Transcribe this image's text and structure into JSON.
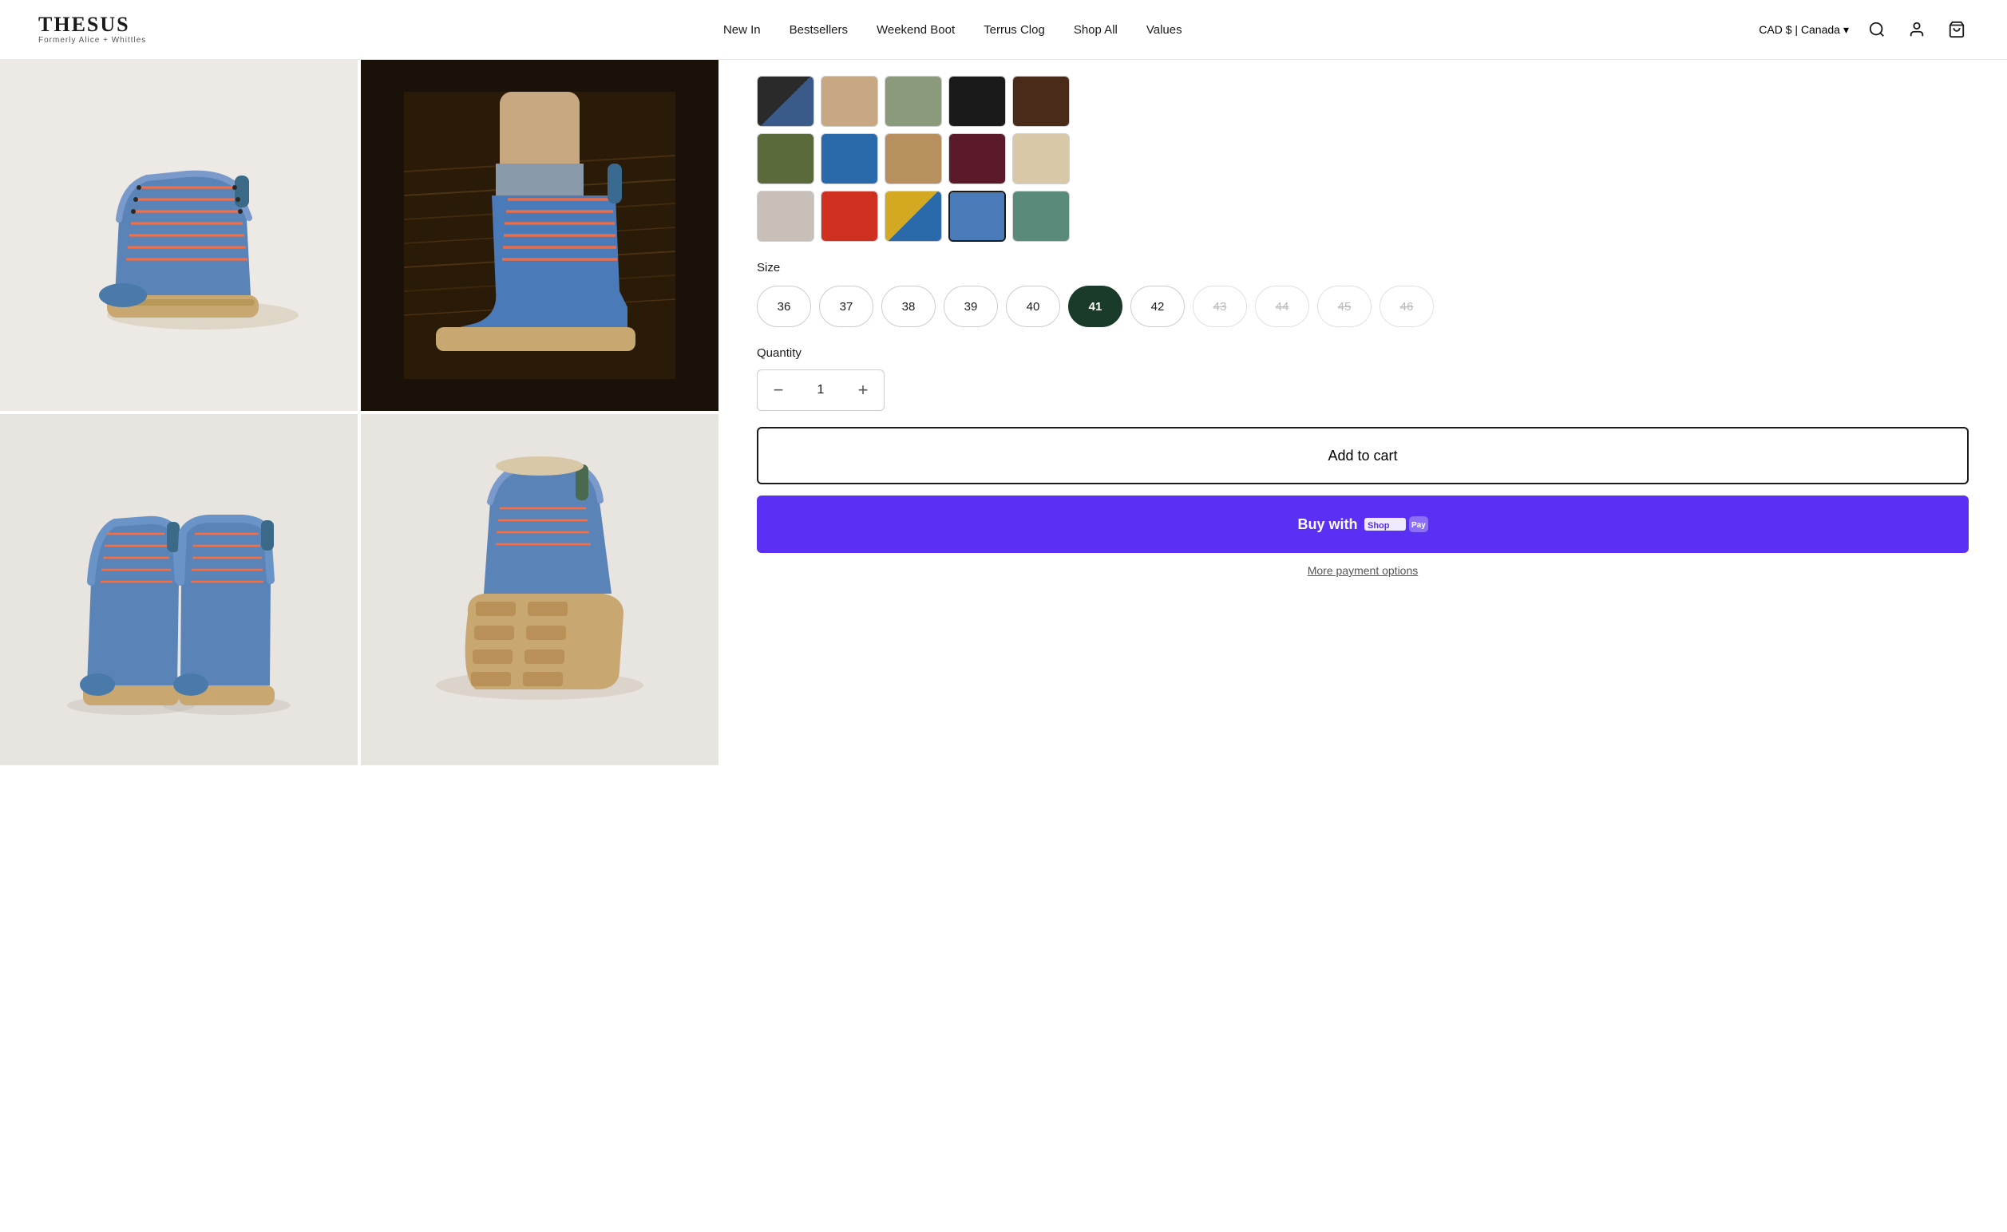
{
  "brand": {
    "name": "THESUS",
    "subtitle": "Formerly Alice + Whittles"
  },
  "nav": {
    "items": [
      {
        "id": "new-in",
        "label": "New In"
      },
      {
        "id": "bestsellers",
        "label": "Bestsellers"
      },
      {
        "id": "weekend-boot",
        "label": "Weekend Boot"
      },
      {
        "id": "terrus-clog",
        "label": "Terrus Clog"
      },
      {
        "id": "shop-all",
        "label": "Shop All"
      },
      {
        "id": "values",
        "label": "Values"
      }
    ]
  },
  "header": {
    "currency": "CAD $ | Canada",
    "currency_chevron": "▾"
  },
  "product": {
    "color_swatches": [
      {
        "id": "sw1",
        "color_class": "sw-black-blue",
        "selected": false
      },
      {
        "id": "sw2",
        "color_class": "sw-tan",
        "selected": false
      },
      {
        "id": "sw3",
        "color_class": "sw-khaki",
        "selected": false
      },
      {
        "id": "sw4",
        "color_class": "sw-black",
        "selected": false
      },
      {
        "id": "sw5",
        "color_class": "sw-dark-brown",
        "selected": false
      },
      {
        "id": "sw6",
        "color_class": "sw-olive",
        "selected": false
      },
      {
        "id": "sw7",
        "color_class": "sw-blue",
        "selected": false
      },
      {
        "id": "sw8",
        "color_class": "sw-tan-dark",
        "selected": false
      },
      {
        "id": "sw9",
        "color_class": "sw-burgundy",
        "selected": false
      },
      {
        "id": "sw10",
        "color_class": "sw-cream",
        "selected": false
      },
      {
        "id": "sw11",
        "color_class": "sw-light-gray",
        "selected": false
      },
      {
        "id": "sw12",
        "color_class": "sw-red",
        "selected": false
      },
      {
        "id": "sw13",
        "color_class": "sw-yellow-blue",
        "selected": false
      },
      {
        "id": "sw14",
        "color_class": "sw-blue-selected",
        "selected": true
      },
      {
        "id": "sw15",
        "color_class": "sw-teal",
        "selected": false
      }
    ],
    "size_label": "Size",
    "sizes": [
      {
        "value": "36",
        "available": true,
        "selected": false
      },
      {
        "value": "37",
        "available": true,
        "selected": false
      },
      {
        "value": "38",
        "available": true,
        "selected": false
      },
      {
        "value": "39",
        "available": true,
        "selected": false
      },
      {
        "value": "40",
        "available": true,
        "selected": false
      },
      {
        "value": "41",
        "available": true,
        "selected": true
      },
      {
        "value": "42",
        "available": true,
        "selected": false
      },
      {
        "value": "43",
        "available": false,
        "selected": false
      },
      {
        "value": "44",
        "available": false,
        "selected": false
      },
      {
        "value": "45",
        "available": false,
        "selected": false
      },
      {
        "value": "46",
        "available": false,
        "selected": false
      }
    ],
    "quantity_label": "Quantity",
    "quantity": 1,
    "add_to_cart_label": "Add to cart",
    "buy_now_label": "Buy with",
    "shop_pay_label": "Shop Pay",
    "more_payment_label": "More payment options"
  }
}
